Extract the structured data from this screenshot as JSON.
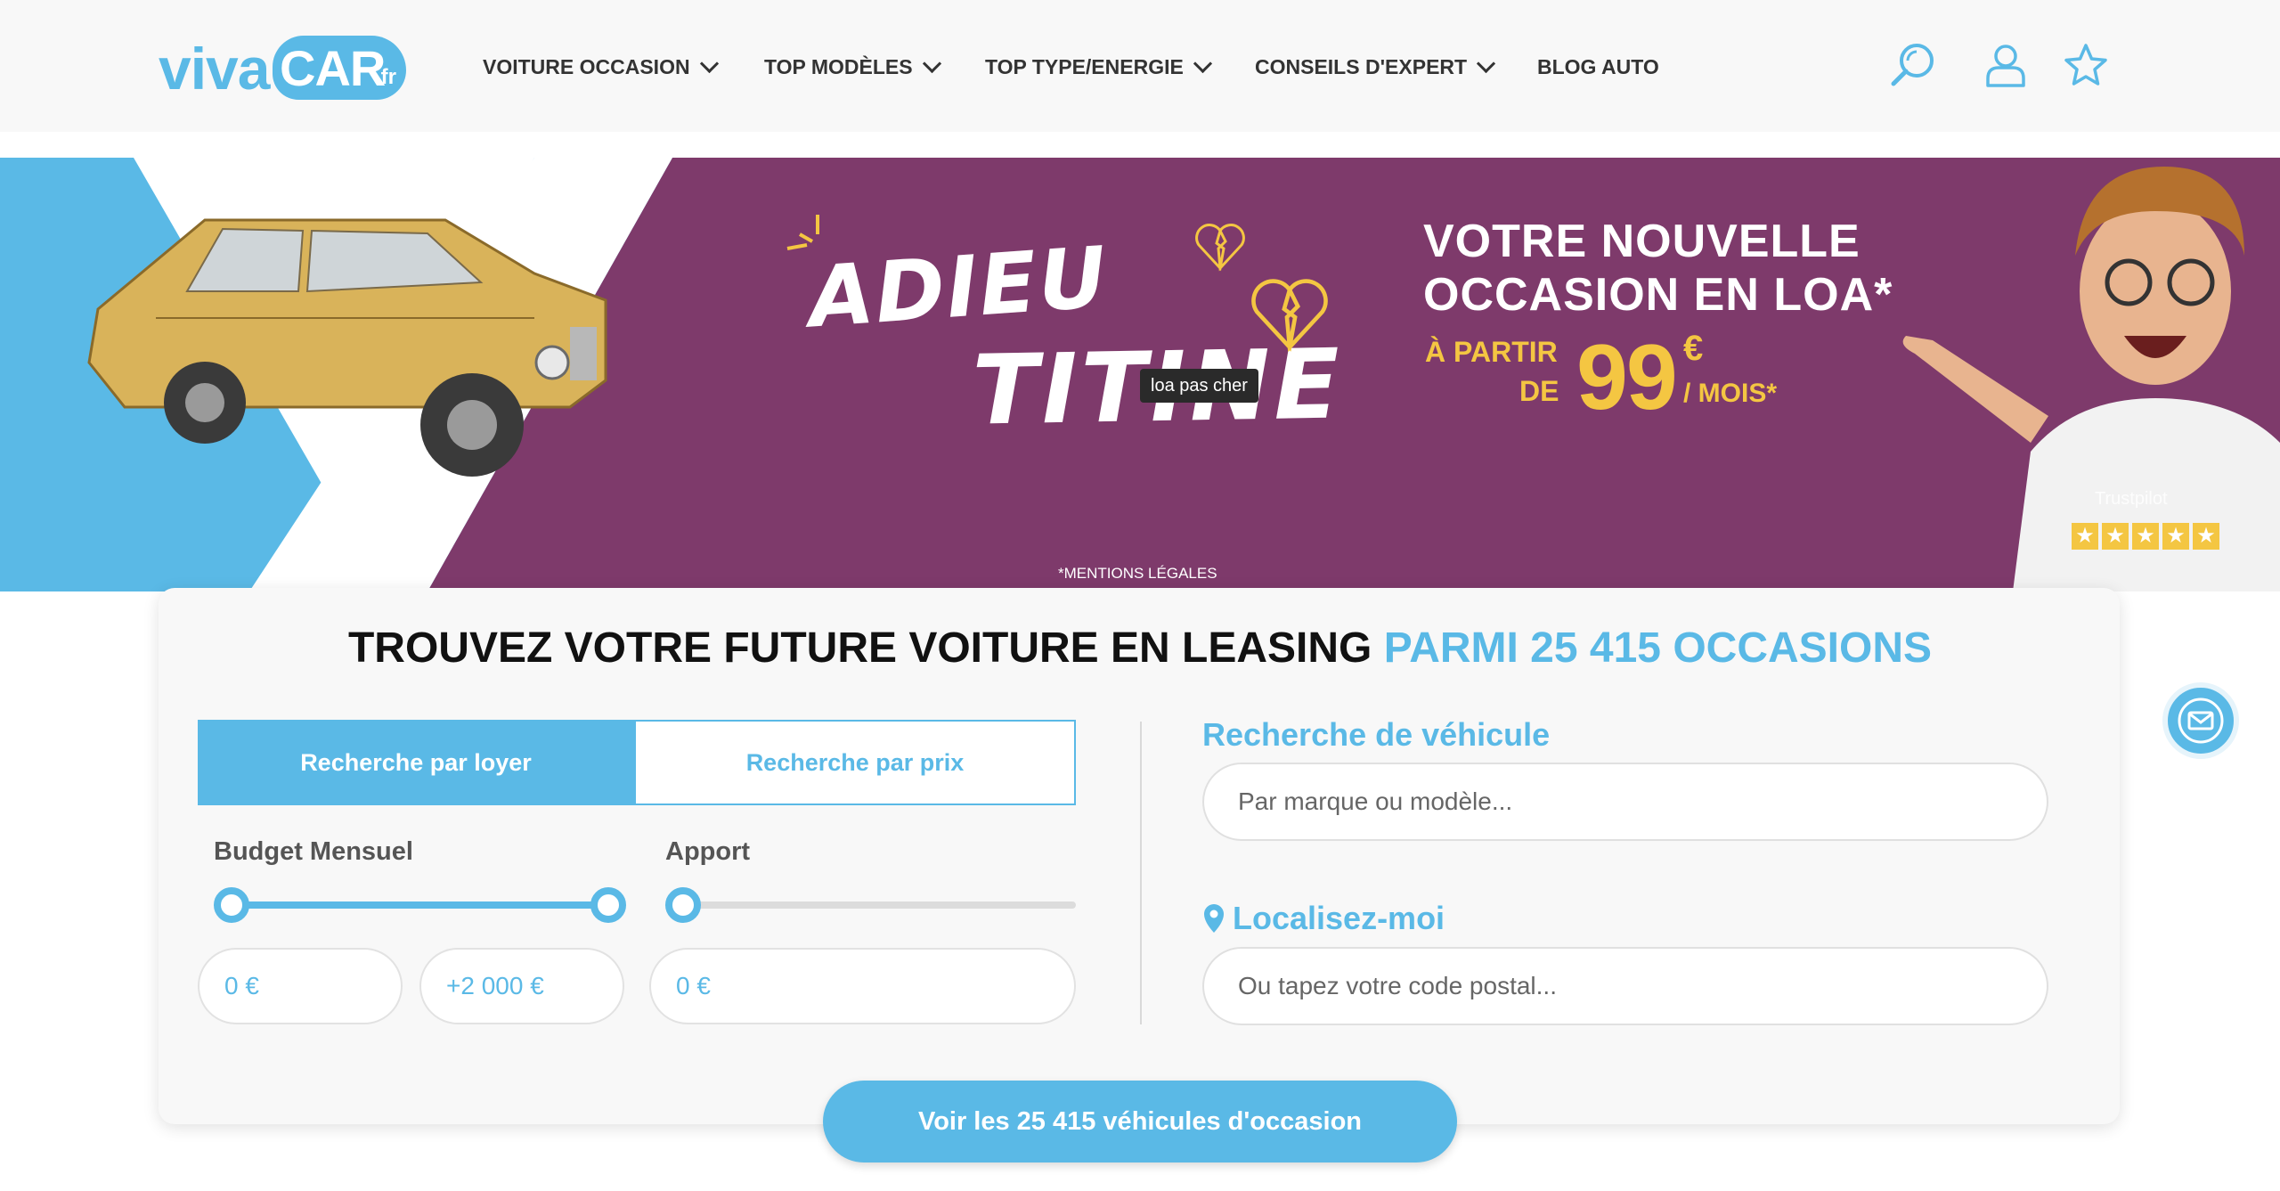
{
  "brand": {
    "logo_main": "viva",
    "logo_car": "CAR",
    "logo_tld": ".fr"
  },
  "nav": [
    {
      "label": "VOITURE OCCASION",
      "dropdown": true
    },
    {
      "label": "TOP MODÈLES",
      "dropdown": true
    },
    {
      "label": "TOP TYPE/ENERGIE",
      "dropdown": true
    },
    {
      "label": "CONSEILS D'EXPERT",
      "dropdown": true
    },
    {
      "label": "BLOG AUTO",
      "dropdown": false
    }
  ],
  "header_icons": [
    "search-icon",
    "user-icon",
    "star-icon"
  ],
  "banner": {
    "headline_1": "ADIEU",
    "headline_2": "TITINE",
    "tooltip": "loa pas cher",
    "promo_line1": "VOTRE NOUVELLE",
    "promo_line2": "OCCASION EN LOA*",
    "promo_from": "À PARTIR",
    "promo_de": "DE",
    "promo_price": "99",
    "promo_currency": "€",
    "promo_period": "/ MOIS*",
    "legal": "*MENTIONS LÉGALES",
    "trustpilot": "Trustpilot",
    "trustpilot_rating": 5
  },
  "search": {
    "title_main": "TROUVEZ VOTRE FUTURE VOITURE EN LEASING",
    "title_highlight": "PARMI 25 415 OCCASIONS",
    "tabs": [
      {
        "label": "Recherche par loyer",
        "active": true
      },
      {
        "label": "Recherche par prix",
        "active": false
      }
    ],
    "budget": {
      "label": "Budget Mensuel",
      "min_value": "0 €",
      "max_value": "+2 000 €",
      "min_level": 0,
      "max_level": 1
    },
    "apport": {
      "label": "Apport",
      "value": "0 €",
      "level": 0
    },
    "vehicle": {
      "label": "Recherche de véhicule",
      "placeholder": "Par marque ou modèle..."
    },
    "location": {
      "label": "Localisez-moi",
      "placeholder": "Ou tapez votre code postal..."
    },
    "cta": "Voir les 25 415 véhicules d'occasion"
  },
  "colors": {
    "accent": "#5ab9e6",
    "banner_purple": "#7e3a6b",
    "promo_yellow": "#f4c642"
  }
}
